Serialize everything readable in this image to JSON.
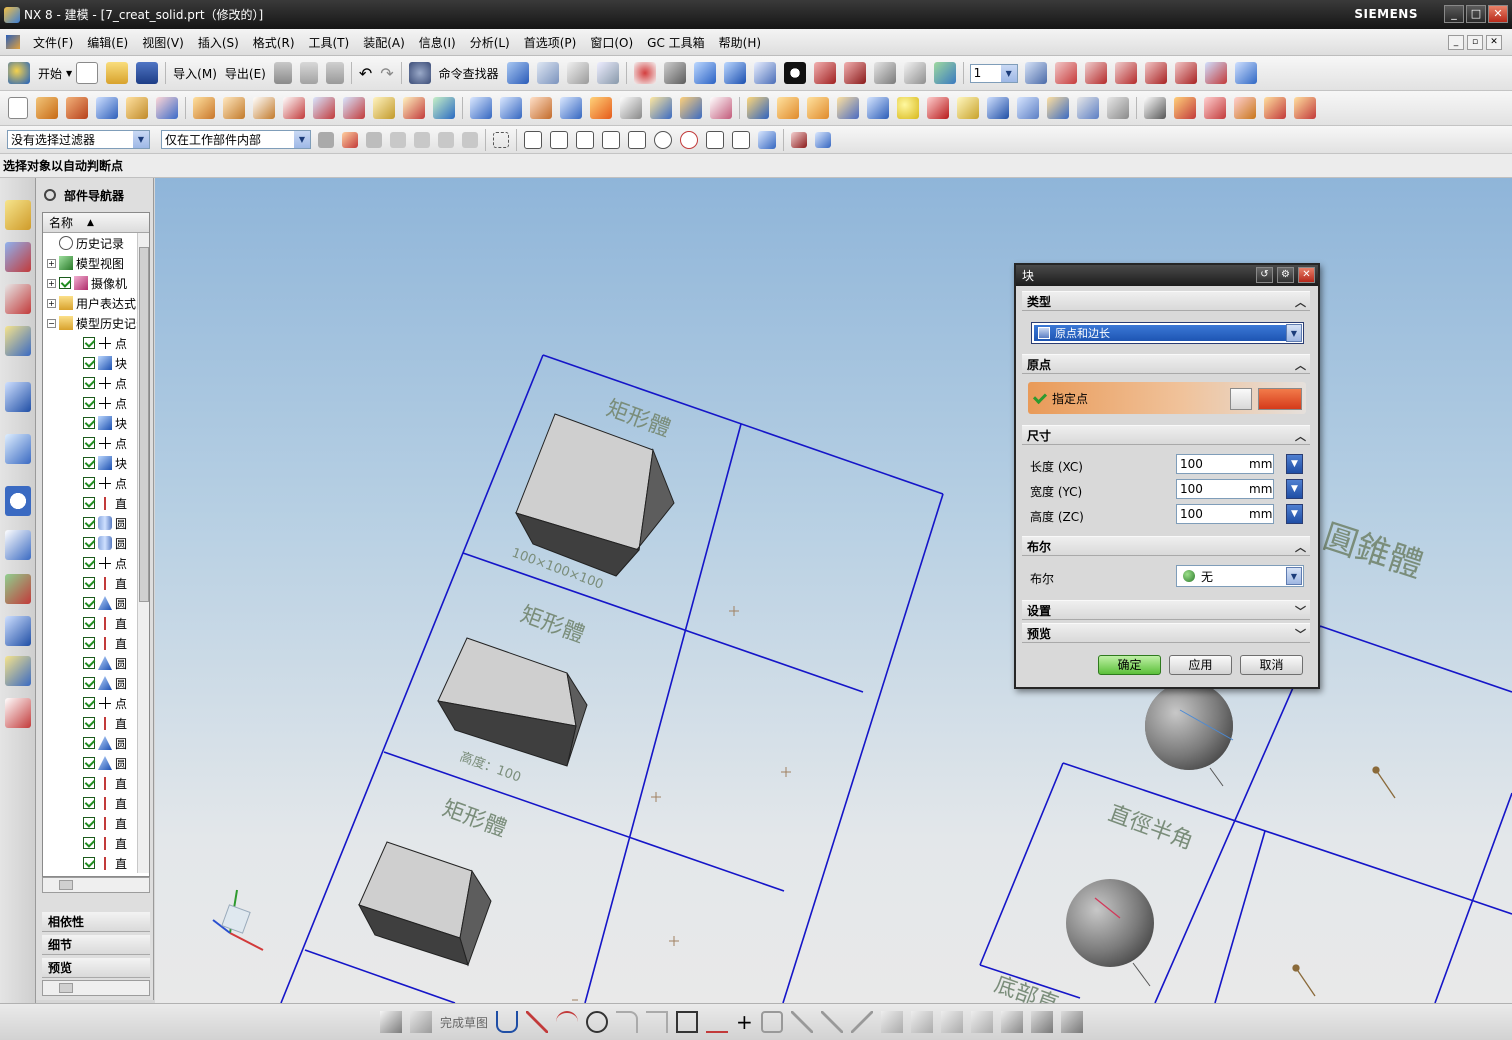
{
  "window": {
    "title": "NX 8 - 建模 - [7_creat_solid.prt（修改的）]",
    "brand": "SIEMENS"
  },
  "menubar": {
    "items": [
      "文件(F)",
      "编辑(E)",
      "视图(V)",
      "插入(S)",
      "格式(R)",
      "工具(T)",
      "装配(A)",
      "信息(I)",
      "分析(L)",
      "首选项(P)",
      "窗口(O)",
      "GC 工具箱",
      "帮助(H)"
    ]
  },
  "toolbar1": {
    "start_label": "开始",
    "import_label": "导入(M)",
    "export_label": "导出(E)",
    "command_finder_label": "命令查找器",
    "layer_value": "1"
  },
  "selection_bar": {
    "filter_value": "没有选择过滤器",
    "scope_value": "仅在工作部件内部"
  },
  "cue_line": {
    "text": "选择对象以自动判断点"
  },
  "part_navigator": {
    "title": "部件导航器",
    "column_header": "名称",
    "top_nodes": [
      {
        "label": "历史记录",
        "icon": "clock-icon"
      },
      {
        "label": "模型视图",
        "icon": "model-views-icon"
      },
      {
        "label": "摄像机",
        "icon": "camera-icon"
      },
      {
        "label": "用户表达式",
        "icon": "folder-icon"
      },
      {
        "label": "模型历史记录",
        "icon": "folder-icon"
      }
    ],
    "features": [
      {
        "label": "点",
        "icon": "point-icon"
      },
      {
        "label": "块",
        "icon": "block-icon"
      },
      {
        "label": "点",
        "icon": "point-icon"
      },
      {
        "label": "点",
        "icon": "point-icon"
      },
      {
        "label": "块",
        "icon": "block-icon"
      },
      {
        "label": "点",
        "icon": "point-icon"
      },
      {
        "label": "块",
        "icon": "block-icon"
      },
      {
        "label": "点",
        "icon": "point-icon"
      },
      {
        "label": "直",
        "icon": "datum-axis-icon"
      },
      {
        "label": "圆",
        "icon": "cylinder-icon"
      },
      {
        "label": "圆",
        "icon": "cylinder-icon"
      },
      {
        "label": "点",
        "icon": "point-icon"
      },
      {
        "label": "直",
        "icon": "datum-axis-icon"
      },
      {
        "label": "圆",
        "icon": "cone-icon"
      },
      {
        "label": "直",
        "icon": "datum-axis-icon"
      },
      {
        "label": "直",
        "icon": "datum-axis-icon"
      },
      {
        "label": "圆",
        "icon": "cone-icon"
      },
      {
        "label": "圆",
        "icon": "cone-icon"
      },
      {
        "label": "点",
        "icon": "point-icon"
      },
      {
        "label": "直",
        "icon": "datum-axis-icon"
      },
      {
        "label": "圆",
        "icon": "cone-icon"
      },
      {
        "label": "圆",
        "icon": "cone-icon"
      },
      {
        "label": "直",
        "icon": "datum-axis-icon"
      },
      {
        "label": "直",
        "icon": "datum-axis-icon"
      },
      {
        "label": "直",
        "icon": "datum-axis-icon"
      },
      {
        "label": "直",
        "icon": "datum-axis-icon"
      },
      {
        "label": "直",
        "icon": "datum-axis-icon"
      }
    ],
    "panels": [
      "相依性",
      "细节",
      "预览"
    ]
  },
  "graphics": {
    "annotations": {
      "rect_title": "矩形體",
      "rect_dim_1": "100×100×100",
      "rect_dim_2": "高度：100",
      "cone_title": "圓錐體",
      "cone_label": "直徑半角",
      "cone_label_2": "底部直"
    }
  },
  "dialog": {
    "title": "块",
    "type_group": "类型",
    "type_value": "原点和边长",
    "origin_group": "原点",
    "specify_point": "指定点",
    "dimensions_group": "尺寸",
    "dimensions": [
      {
        "label": "长度 (XC)",
        "value": "100",
        "unit": "mm"
      },
      {
        "label": "宽度 (YC)",
        "value": "100",
        "unit": "mm"
      },
      {
        "label": "高度 (ZC)",
        "value": "100",
        "unit": "mm"
      }
    ],
    "boolean_group": "布尔",
    "boolean_label": "布尔",
    "boolean_value": "无",
    "settings_group": "设置",
    "preview_group": "预览",
    "ok_label": "确定",
    "apply_label": "应用",
    "cancel_label": "取消"
  },
  "bottom_toolbar": {
    "finish_sketch_label": "完成草图"
  },
  "colors": {
    "title_bar": "#1f1f1f",
    "dialog_point_row": "#e99a58",
    "ok_button": "#5cc03a",
    "drawing_lines": "#1515c8",
    "graphics_top": "#8fb5d9"
  }
}
